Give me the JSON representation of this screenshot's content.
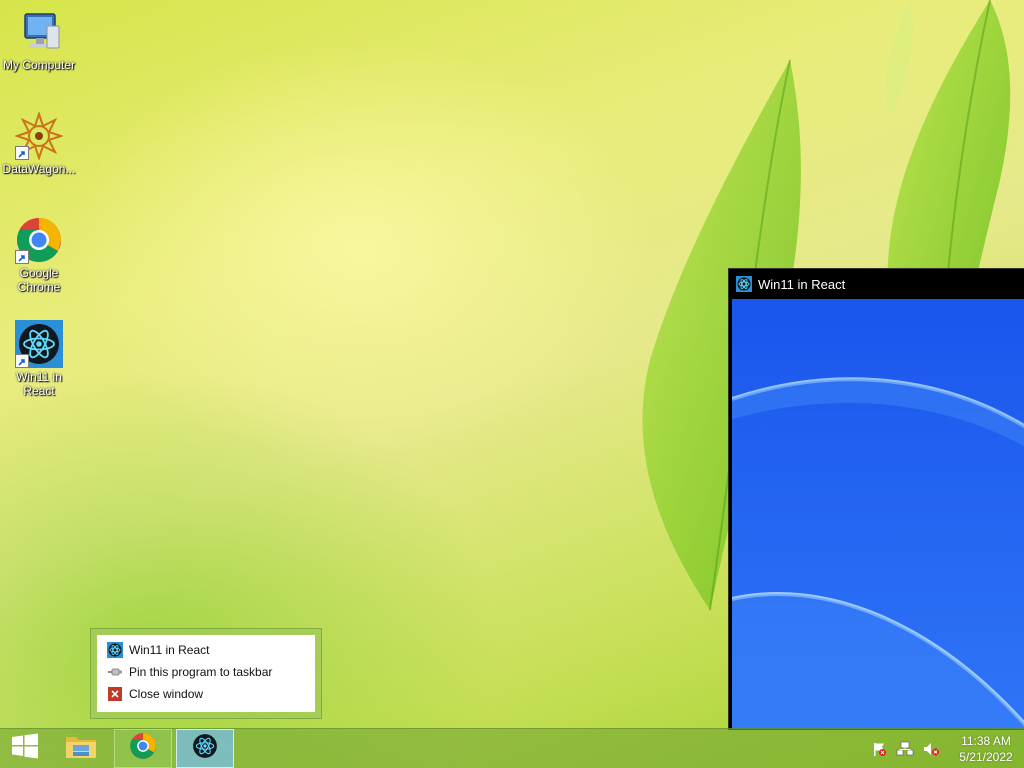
{
  "desktop": {
    "icons": [
      {
        "label": "My Computer",
        "icon": "computer-icon"
      },
      {
        "label": "DataWagon...",
        "icon": "datawagon-icon"
      },
      {
        "label": "Google Chrome",
        "icon": "chrome-icon"
      },
      {
        "label": "Win11 in React",
        "icon": "react-icon"
      }
    ]
  },
  "window": {
    "title": "Win11 in React",
    "icon": "react-icon"
  },
  "jumplist": {
    "items": [
      {
        "label": "Win11 in React",
        "icon": "react-icon"
      },
      {
        "label": "Pin this program to taskbar",
        "icon": "pin-icon"
      },
      {
        "label": "Close window",
        "icon": "close-icon"
      }
    ]
  },
  "taskbar": {
    "buttons": [
      "start-icon",
      "file-explorer-icon",
      "chrome-icon",
      "react-icon"
    ],
    "tray": {
      "icons": [
        "action-center-flag-icon",
        "network-icon",
        "speaker-muted-icon"
      ],
      "time": "11:38 AM",
      "date": "5/21/2022"
    }
  },
  "colors": {
    "window_content": "#1f63f3",
    "accent_react": "#61dafb",
    "close_icon": "#c0392b"
  }
}
